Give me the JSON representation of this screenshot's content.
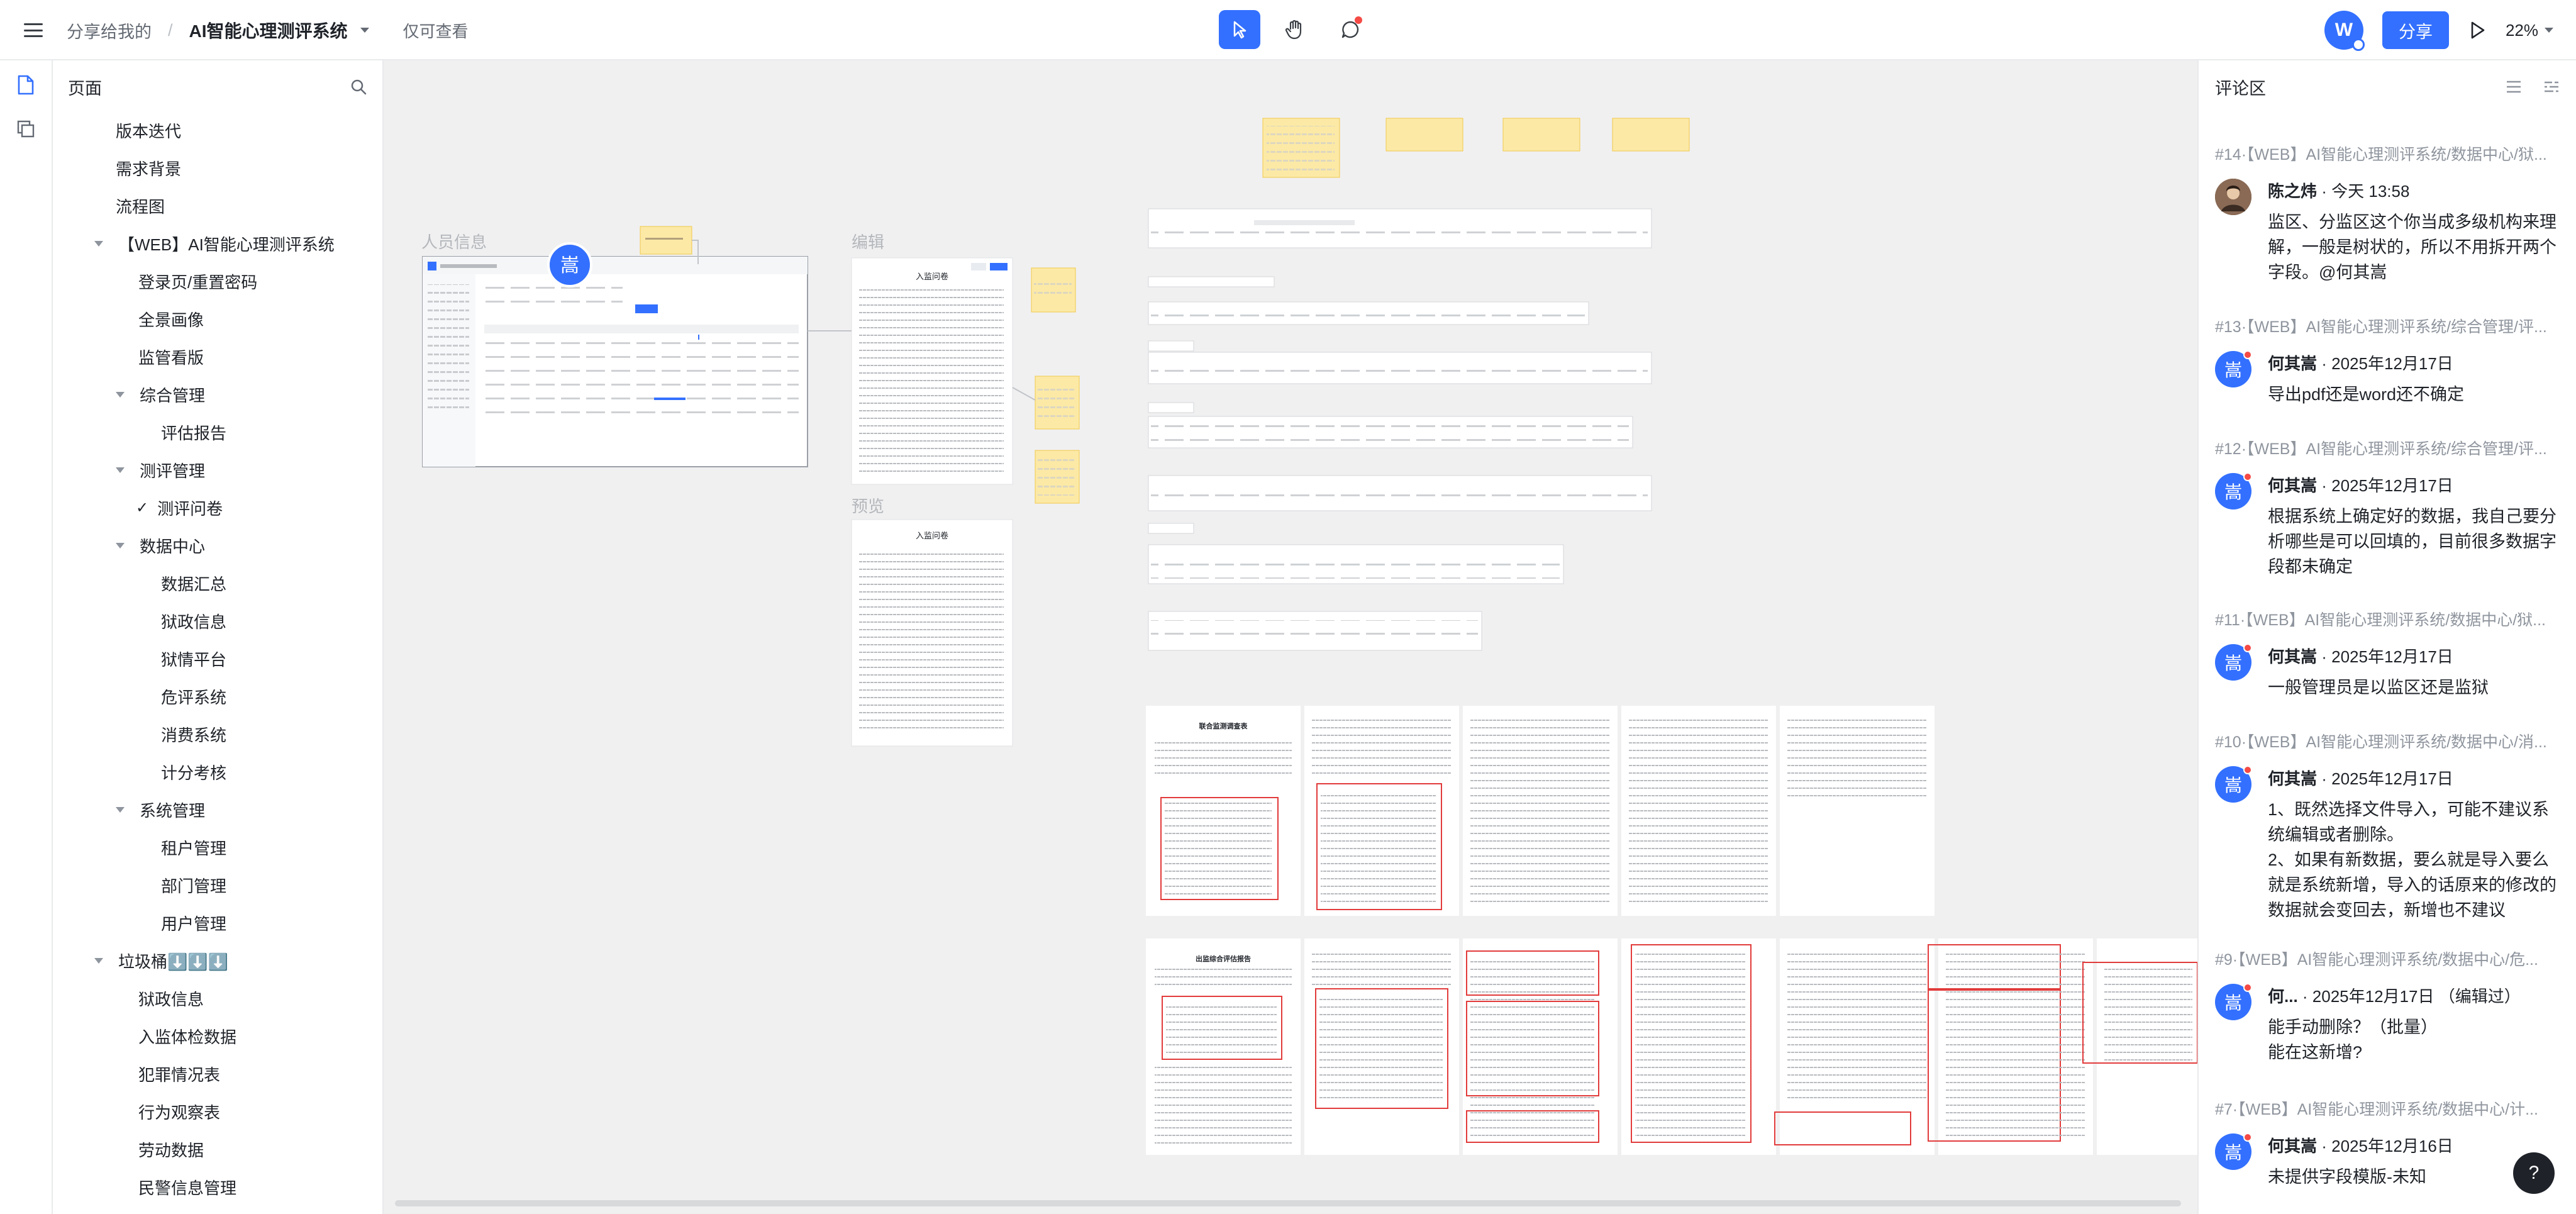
{
  "topbar": {
    "breadcrumb_parent": "分享给我的",
    "separator": "/",
    "doc_title": "AI智能心理测评系统",
    "permission": "仅可查看",
    "avatar_letter": "W",
    "share_label": "分享",
    "zoom": "22%"
  },
  "sidebar": {
    "title": "页面",
    "nodes": [
      {
        "label": "版本迭代"
      },
      {
        "label": "需求背景"
      },
      {
        "label": "流程图"
      },
      {
        "label": "【WEB】AI智能心理测评系统"
      },
      {
        "label": "登录页/重置密码"
      },
      {
        "label": "全景画像"
      },
      {
        "label": "监管看版"
      },
      {
        "label": "综合管理"
      },
      {
        "label": "评估报告"
      },
      {
        "label": "测评管理"
      },
      {
        "label": "测评问卷"
      },
      {
        "label": "数据中心"
      },
      {
        "label": "数据汇总"
      },
      {
        "label": "狱政信息"
      },
      {
        "label": "狱情平台"
      },
      {
        "label": "危评系统"
      },
      {
        "label": "消费系统"
      },
      {
        "label": "计分考核"
      },
      {
        "label": "系统管理"
      },
      {
        "label": "租户管理"
      },
      {
        "label": "部门管理"
      },
      {
        "label": "用户管理"
      },
      {
        "label": "垃圾桶⬇️⬇️⬇️"
      },
      {
        "label": "狱政信息"
      },
      {
        "label": "入监体检数据"
      },
      {
        "label": "犯罪情况表"
      },
      {
        "label": "行为观察表"
      },
      {
        "label": "劳动数据"
      },
      {
        "label": "民警信息管理"
      }
    ]
  },
  "canvas": {
    "label_person": "人员信息",
    "label_edit": "编辑",
    "label_preview": "预览",
    "avatar_char": "嵩",
    "form_title_edit": "入监问卷",
    "form_title_preview": "入监问卷",
    "doc_title_1": "联合监测调查表",
    "doc_title_2": "出监综合评估报告"
  },
  "comments": {
    "title": "评论区",
    "items": [
      {
        "ref": "#14·【WEB】AI智能心理测评系统/数据中心/狱...",
        "author": "陈之炜",
        "time": "· 今天 13:58",
        "body": "监区、分监区这个你当成多级机构来理解，一般是树状的，所以不用拆开两个字段。@何其嵩",
        "avatar": ""
      },
      {
        "ref": "#13·【WEB】AI智能心理测评系统/综合管理/评...",
        "author": "何其嵩",
        "time": "· 2025年12月17日",
        "body": "导出pdf还是word还不确定",
        "avatar": "嵩"
      },
      {
        "ref": "#12·【WEB】AI智能心理测评系统/综合管理/评...",
        "author": "何其嵩",
        "time": "· 2025年12月17日",
        "body": "根据系统上确定好的数据，我自己要分析哪些是可以回填的，目前很多数据字段都未确定",
        "avatar": "嵩"
      },
      {
        "ref": "#11·【WEB】AI智能心理测评系统/数据中心/狱...",
        "author": "何其嵩",
        "time": "· 2025年12月17日",
        "body": "一般管理员是以监区还是监狱",
        "avatar": "嵩"
      },
      {
        "ref": "#10·【WEB】AI智能心理测评系统/数据中心/消...",
        "author": "何其嵩",
        "time": "· 2025年12月17日",
        "body": "1、既然选择文件导入，可能不建议系统编辑或者删除。\n2、如果有新数据，要么就是导入要么就是系统新增，导入的话原来的修改的数据就会变回去，新增也不建议",
        "avatar": "嵩"
      },
      {
        "ref": "#9·【WEB】AI智能心理测评系统/数据中心/危...",
        "author": "何...",
        "time": "· 2025年12月17日 （编辑过）",
        "body": "能手动删除？（批量）\n能在这新增?",
        "avatar": "嵩"
      },
      {
        "ref": "#7·【WEB】AI智能心理测评系统/数据中心/计...",
        "author": "何其嵩",
        "time": "· 2025年12月16日",
        "body": "未提供字段模版-未知",
        "avatar": "嵩"
      }
    ]
  },
  "help_label": "?"
}
